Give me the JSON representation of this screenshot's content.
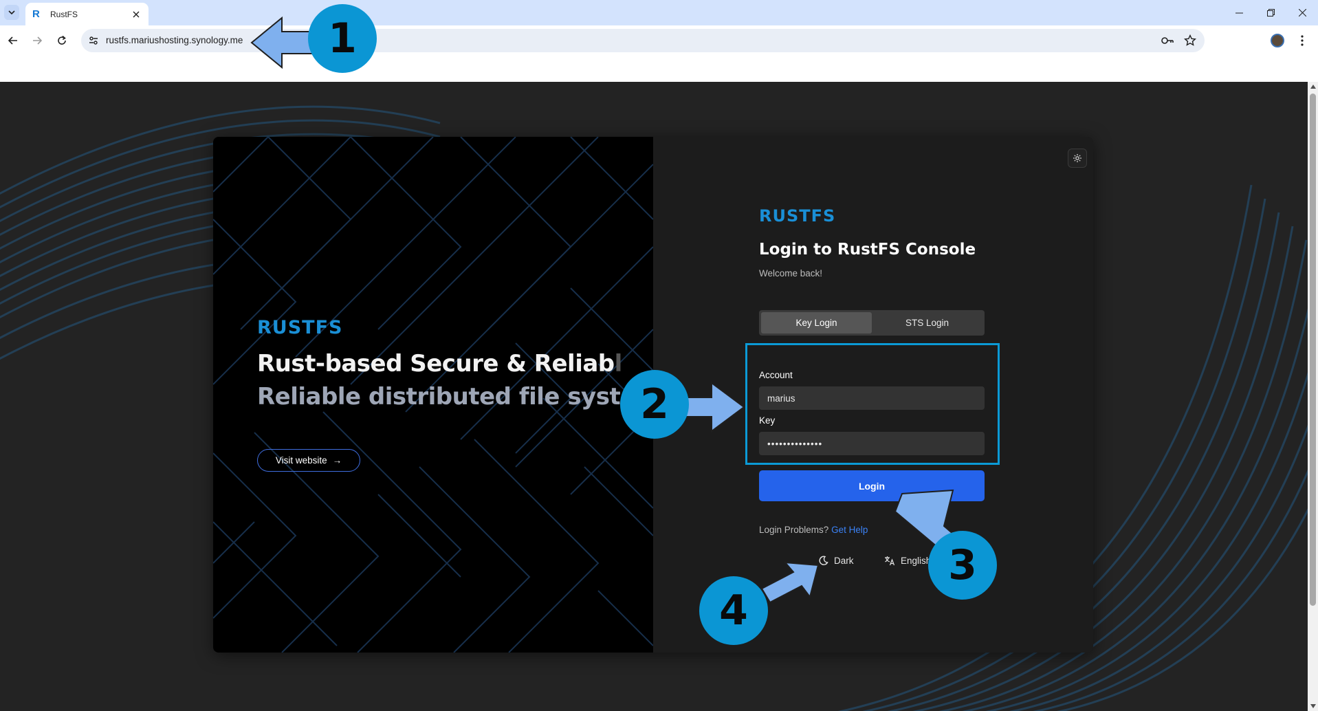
{
  "browser": {
    "tab_title": "RustFS",
    "url": "rustfs.mariushosting.synology.me"
  },
  "hero": {
    "logo": "RUSTFS",
    "headline_a": "Rust-based",
    "headline_b": "Secure & Reliab",
    "headline_faded": "l",
    "subheadline": "Reliable distributed file system",
    "visit_button": "Visit website",
    "visit_arrow": "→"
  },
  "login": {
    "logo": "RUSTFS",
    "title": "Login to RustFS Console",
    "subtitle": "Welcome back!",
    "tabs": [
      {
        "label": "Key Login",
        "active": true
      },
      {
        "label": "STS Login",
        "active": false
      }
    ],
    "account_label": "Account",
    "account_value": "marius",
    "key_label": "Key",
    "key_value": "••••••••••••••",
    "submit": "Login",
    "help_text": "Login Problems?",
    "help_link": "Get Help",
    "theme": "Dark",
    "language": "English"
  },
  "annotations": [
    "1",
    "2",
    "3",
    "4"
  ],
  "colors": {
    "brand": "#1a8fd6",
    "primary_button": "#2563eb",
    "annotation": "#0b96d4",
    "arrow_fill": "#7fb0ee"
  }
}
